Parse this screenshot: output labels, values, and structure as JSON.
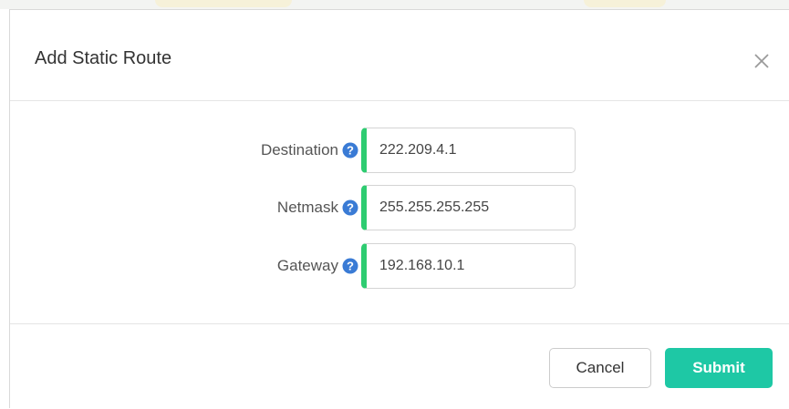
{
  "dialog": {
    "title": "Add Static Route",
    "close_icon": "close-icon"
  },
  "form": {
    "fields": [
      {
        "label": "Destination",
        "value": "222.209.4.1",
        "help_icon": "question-circle-icon"
      },
      {
        "label": "Netmask",
        "value": "255.255.255.255",
        "help_icon": "question-circle-icon"
      },
      {
        "label": "Gateway",
        "value": "192.168.10.1",
        "help_icon": "question-circle-icon"
      }
    ]
  },
  "footer": {
    "cancel_label": "Cancel",
    "submit_label": "Submit"
  },
  "colors": {
    "accent": "#1ec8a5",
    "valid_border": "#2ecc71",
    "help_icon": "#3a7bd5"
  }
}
